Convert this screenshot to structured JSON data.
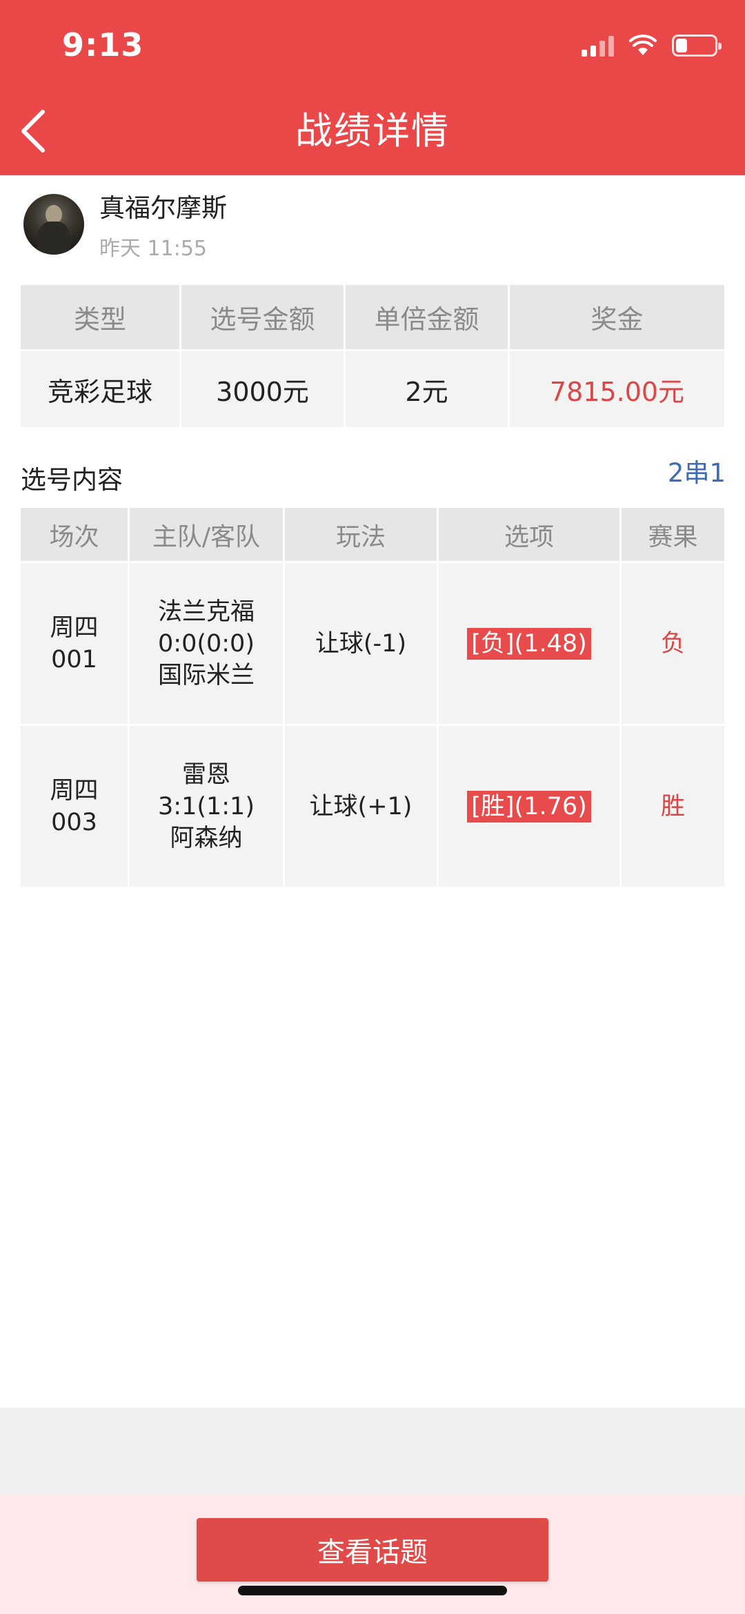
{
  "status_bar": {
    "time": "9:13"
  },
  "header": {
    "title": "战绩详情"
  },
  "user": {
    "name": "真福尔摩斯",
    "time": "昨天 11:55"
  },
  "summary": {
    "headers": [
      "类型",
      "选号金额",
      "单倍金额",
      "奖金"
    ],
    "values": [
      "竞彩足球",
      "3000元",
      "2元",
      "7815.00元"
    ]
  },
  "selection": {
    "title": "选号内容",
    "series": "2串1",
    "headers": [
      "场次",
      "主队/客队",
      "玩法",
      "选项",
      "赛果"
    ],
    "rows": [
      {
        "match_day": "周四",
        "match_no": "001",
        "home": "法兰克福",
        "score": "0:0(0:0)",
        "away": "国际米兰",
        "play": "让球(-1)",
        "pick": "[负](1.48)",
        "result": "负"
      },
      {
        "match_day": "周四",
        "match_no": "003",
        "home": "雷恩",
        "score": "3:1(1:1)",
        "away": "阿森纳",
        "play": "让球(+1)",
        "pick": "[胜](1.76)",
        "result": "胜"
      }
    ]
  },
  "footer": {
    "button_label": "查看话题"
  },
  "colors": {
    "primary_red": "#ea4848",
    "series_blue": "#3f6bb3",
    "result_red": "#d94747"
  }
}
